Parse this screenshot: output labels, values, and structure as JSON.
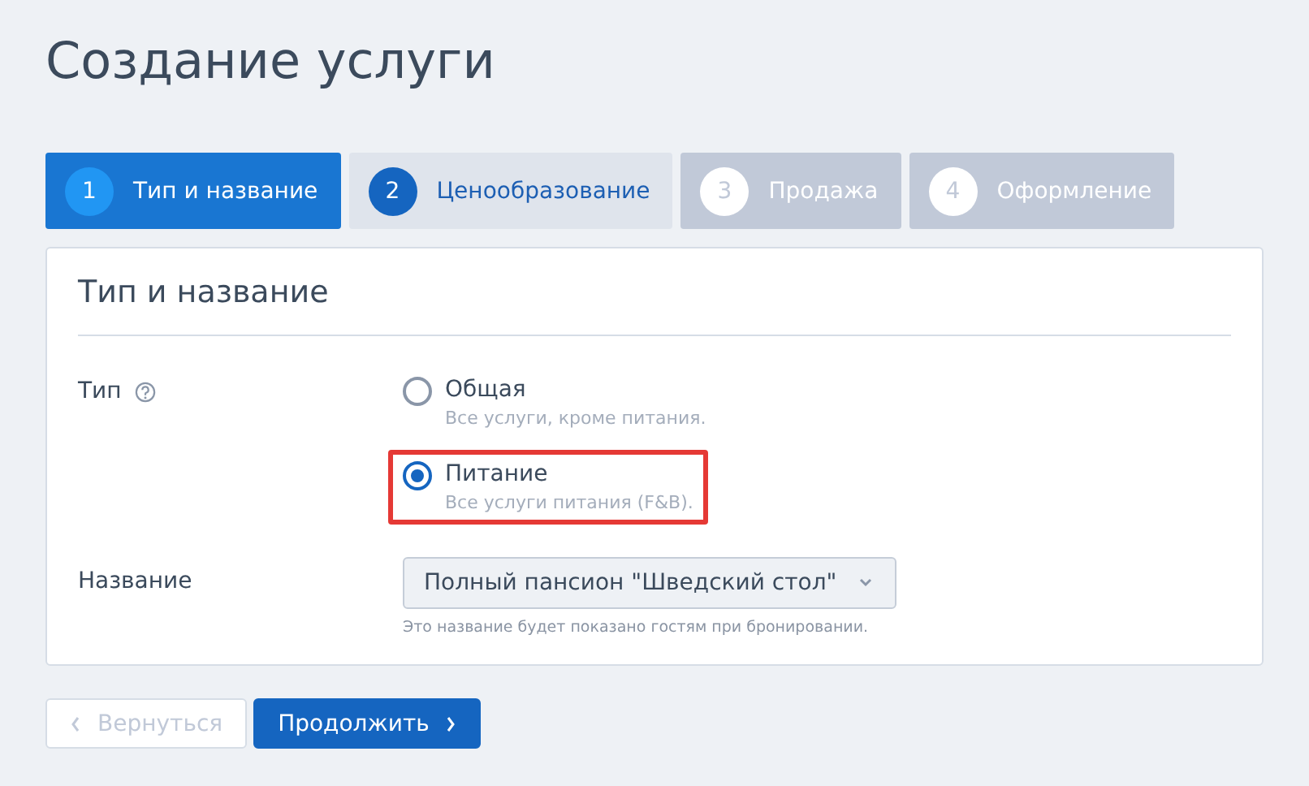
{
  "title": "Создание услуги",
  "steps": [
    {
      "number": "1",
      "label": "Тип и название",
      "selected": true,
      "disabled": false
    },
    {
      "number": "2",
      "label": "Ценообразование",
      "selected": false,
      "disabled": false
    },
    {
      "number": "3",
      "label": "Продажа",
      "selected": false,
      "disabled": true
    },
    {
      "number": "4",
      "label": "Оформление",
      "selected": false,
      "disabled": true
    }
  ],
  "card": {
    "title": "Тип и название",
    "type_field": {
      "label": "Тип",
      "options": [
        {
          "label": "Общая",
          "hint": "Все услуги, кроме питания.",
          "selected": false,
          "highlighted": false
        },
        {
          "label": "Питание",
          "hint": "Все услуги питания (F&B).",
          "selected": true,
          "highlighted": true
        }
      ]
    },
    "name_field": {
      "label": "Название",
      "value": "Полный пансион \"Шведский стол\"",
      "hint": "Это название будет показано гостям при бронировании."
    }
  },
  "buttons": [
    {
      "label": "Вернуться",
      "kind": "back",
      "disabled": true
    },
    {
      "label": "Продолжить",
      "kind": "next",
      "disabled": false
    }
  ]
}
